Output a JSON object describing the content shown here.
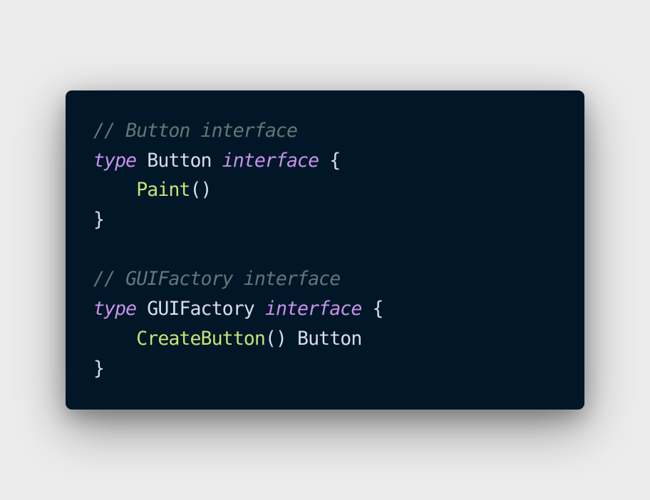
{
  "colors": {
    "page_background": "#ececec",
    "card_background": "#011627",
    "comment": "#637777",
    "keyword": "#c792ea",
    "function": "#c5e478",
    "text": "#d6deeb"
  },
  "code": {
    "language": "go",
    "lines": [
      {
        "comment": "// Button interface"
      },
      {
        "keyword": "type",
        "name": "Button",
        "keyword2": "interface",
        "brace": "{"
      },
      {
        "indent": "    ",
        "func": "Paint",
        "parens": "()"
      },
      {
        "brace": "}"
      },
      {
        "blank": ""
      },
      {
        "comment": "// GUIFactory interface"
      },
      {
        "keyword": "type",
        "name": "GUIFactory",
        "keyword2": "interface",
        "brace": "{"
      },
      {
        "indent": "    ",
        "func": "CreateButton",
        "parens": "()",
        "ret": "Button"
      },
      {
        "brace": "}"
      }
    ]
  }
}
